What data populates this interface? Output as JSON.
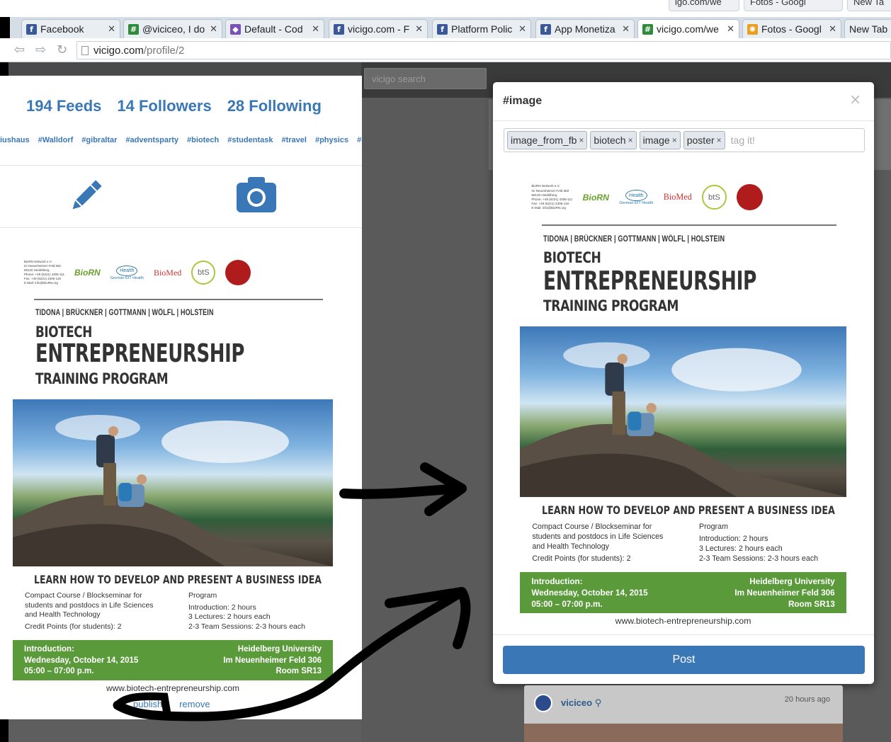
{
  "browser": {
    "ghost_tabs": [
      "igo.com/we",
      "Fotos - Googl",
      "New Ta"
    ],
    "tabs": [
      {
        "label": "Facebook",
        "favicon": "facebook-icon",
        "color": "#3b5998",
        "glyph": "f"
      },
      {
        "label": "@viciceo, I do",
        "favicon": "hashtag-icon",
        "color": "#2e8b3a",
        "glyph": "#"
      },
      {
        "label": "Default - Cod",
        "favicon": "cube-icon",
        "color": "#7b4fb8",
        "glyph": "◆"
      },
      {
        "label": "vicigo.com - F",
        "favicon": "facebook-icon",
        "color": "#3b5998",
        "glyph": "f"
      },
      {
        "label": "Platform Polic",
        "favicon": "facebook-icon",
        "color": "#3b5998",
        "glyph": "f"
      },
      {
        "label": "App Monetiza",
        "favicon": "facebook-icon",
        "color": "#3b5998",
        "glyph": "f"
      },
      {
        "label": "vicigo.com/we",
        "favicon": "hashtag-icon",
        "color": "#2e8b3a",
        "glyph": "#"
      },
      {
        "label": "Fotos - Googl",
        "favicon": "pinwheel-icon",
        "color": "#e8a020",
        "glyph": "✺"
      },
      {
        "label": "New Tab",
        "favicon": "",
        "color": "",
        "glyph": ""
      }
    ],
    "url_host": "vicigo.com",
    "url_path": "/profile/2"
  },
  "site": {
    "search_placeholder": "vicigo search"
  },
  "profile": {
    "feeds": "194 Feeds",
    "followers": "14 Followers",
    "following": "28 Following",
    "hashtags": [
      "iushaus",
      "#Walldorf",
      "#gibraltar",
      "#adventsparty",
      "#biotech",
      "#studentask",
      "#travel",
      "#physics",
      "#s"
    ],
    "publish": "publish",
    "remove": "remove"
  },
  "poster": {
    "org_lines": [
      "BioRN Network e.V.",
      "Im Neuenheimer Feld 582",
      "69120 Heidelberg",
      "Phone: +49 (6221) 4305-111",
      "Fax: +49 (6221) 4305-119",
      "E-Mail: info@BioRN.org"
    ],
    "logo_biorn": "BioRN",
    "logo_eit": "Health",
    "logo_eit_sub": "German EIT Health",
    "logo_biomed": "BioMed",
    "logo_bts": "btS",
    "names": "TIDONA | BRÜCKNER | GOTTMANN | WÖLFL | HOLSTEIN",
    "line1": "BIOTECH",
    "line2": "ENTREPRENEURSHIP",
    "line3": "TRAINING PROGRAM",
    "learn": "LEARN HOW TO DEVELOP AND PRESENT A BUSINESS IDEA",
    "course": [
      "Compact Course / Blockseminar for",
      "students and postdocs in Life Sciences",
      "and Health Technology"
    ],
    "credits": "Credit Points (for students): 2",
    "program_title": "Program",
    "program": [
      "Introduction: 2 hours",
      "3 Lectures: 2 hours each",
      "2-3 Team Sessions: 2-3 hours each"
    ],
    "intro": [
      "Introduction:",
      "Wednesday, October 14, 2015",
      "05:00 – 07:00 p.m."
    ],
    "venue": [
      "Heidelberg University",
      "Im Neuenheimer Feld 306",
      "Room SR13"
    ],
    "url": "www.biotech-entrepreneurship.com"
  },
  "modal": {
    "title": "#image",
    "close": "×",
    "tags": [
      "image_from_fb",
      "biotech",
      "image",
      "poster"
    ],
    "tag_placeholder": "tag it!",
    "post_label": "Post"
  },
  "feed": {
    "author": "viciceo",
    "time": "20 hours ago"
  },
  "colors": {
    "link_blue": "#3a77b6",
    "poster_green": "#5a9a3a"
  }
}
